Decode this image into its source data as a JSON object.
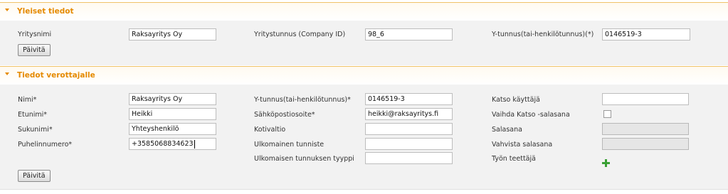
{
  "general": {
    "title": "Yleiset tiedot",
    "company_name_label": "Yritysnimi",
    "company_name_value": "Raksayritys Oy",
    "company_id_label": "Yritystunnus (Company ID)",
    "company_id_value": "98_6",
    "business_id_label": "Y-tunnus(tai-henkilötunnus)(*)",
    "business_id_value": "0146519-3",
    "update_label": "Päivitä"
  },
  "tax": {
    "title": "Tiedot verottajalle",
    "name_label": "Nimi*",
    "name_value": "Raksayritys Oy",
    "first_name_label": "Etunimi*",
    "first_name_value": "Heikki",
    "last_name_label": "Sukunimi*",
    "last_name_value": "Yhteyshenkilö",
    "phone_label": "Puhelinnumero*",
    "phone_value": "+3585068834623",
    "business_id_label": "Y-tunnus(tai-henkilötunnus)*",
    "business_id_value": "0146519-3",
    "email_label": "Sähköpostiosoite*",
    "email_value": "heikki@raksayritys.fi",
    "home_country_label": "Kotivaltio",
    "home_country_value": "",
    "foreign_id_label": "Ulkomainen tunniste",
    "foreign_id_value": "",
    "foreign_id_type_label": "Ulkomaisen tunnuksen tyyppi",
    "foreign_id_type_value": "",
    "katso_user_label": "Katso käyttäjä",
    "katso_user_value": "",
    "change_katso_password_label": "Vaihda Katso -salasana",
    "change_katso_password_checked": false,
    "password_label": "Salasana",
    "confirm_password_label": "Vahvista salasana",
    "work_commissioner_label": "Työn teettäjä",
    "add_icon": "plus-icon",
    "update_label": "Päivitä"
  },
  "colors": {
    "accent": "#e58a00",
    "section_bg": "#f2f2f2",
    "add_icon": "#3aa035"
  }
}
